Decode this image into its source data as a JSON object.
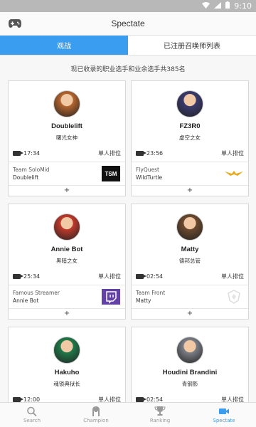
{
  "statusbar": {
    "time": "9:10"
  },
  "appbar": {
    "title": "Spectate"
  },
  "tabs": [
    {
      "label": "观战",
      "active": true
    },
    {
      "label": "已注册召唤师列表",
      "active": false
    }
  ],
  "subtitle": "现已收录的职业选手和业余选手共385名",
  "cards": [
    {
      "name": "Doublelift",
      "champion": "曙光女神",
      "time": "17:34",
      "queue": "单人排位",
      "team": "Team SoloMid",
      "player": "Doublelift",
      "logo": "tsm",
      "avatar_color": "#b5652e"
    },
    {
      "name": "FZ3R0",
      "champion": "虚空之女",
      "time": "23:56",
      "queue": "单人排位",
      "team": "FlyQuest",
      "player": "WildTurtle",
      "logo": "flyquest",
      "avatar_color": "#3a3a6e"
    },
    {
      "name": "Annie Bot",
      "champion": "黑暗之女",
      "time": "25:34",
      "queue": "单人排位",
      "team": "Famous Streamer",
      "player": "Annie Bot",
      "logo": "twitch",
      "avatar_color": "#c0392b"
    },
    {
      "name": "Matty",
      "champion": "德邦总管",
      "time": "02:54",
      "queue": "单人排位",
      "team": "Team Front",
      "player": "Matty",
      "logo": "teamfront",
      "avatar_color": "#6b4a2e"
    },
    {
      "name": "Hakuho",
      "champion": "魂锁典狱长",
      "time": "12:00",
      "queue": "单人排位",
      "team": "",
      "player": "",
      "logo": "",
      "avatar_color": "#1f7a4a"
    },
    {
      "name": "Houdini Brandini",
      "champion": "青钢影",
      "time": "02:54",
      "queue": "单人排位",
      "team": "",
      "player": "",
      "logo": "",
      "avatar_color": "#7b7f86"
    }
  ],
  "plus_label": "+",
  "bottomnav": [
    {
      "label": "Search",
      "icon": "search-icon",
      "active": false
    },
    {
      "label": "Champion",
      "icon": "champion-icon",
      "active": false
    },
    {
      "label": "Ranking",
      "icon": "trophy-icon",
      "active": false
    },
    {
      "label": "Spectate",
      "icon": "video-camera-icon",
      "active": true
    }
  ],
  "colors": {
    "accent": "#3b9df0",
    "statusbar": "#b8b8b8"
  }
}
